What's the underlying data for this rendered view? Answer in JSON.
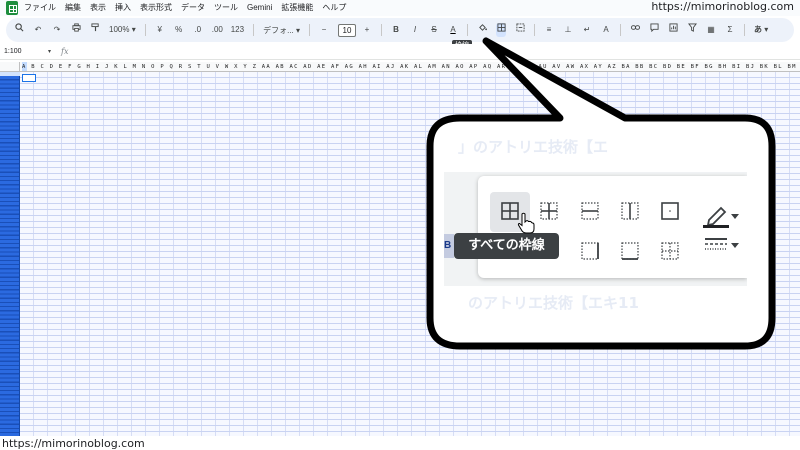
{
  "menubar": {
    "items": [
      "ファイル",
      "編集",
      "表示",
      "挿入",
      "表示形式",
      "データ",
      "ツール",
      "Gemini",
      "拡張機能",
      "ヘルプ"
    ]
  },
  "watermark": {
    "top": "https://mimorinoblog.com",
    "bottom": "https://mimorinoblog.com"
  },
  "toolbar": {
    "zoom": "100%",
    "currency": "¥",
    "percent": "%",
    "decimal_decrease": ".0",
    "decimal_increase": ".00",
    "format_123": "123",
    "font": "デフォ...",
    "font_size": "10",
    "minus": "−",
    "plus": "+",
    "bold": "B",
    "italic": "I",
    "strike": "S",
    "text_color": "A",
    "tooltip": "枠線",
    "more_lang": "あ"
  },
  "formula": {
    "namebox": "1:100",
    "fx": "fx"
  },
  "columns": {
    "letters": "A B C D E F G H I J K L M N O P Q R S T U V W X Y Z AA AB AC AD AE AF AG AH AI AJ AK AL AM AN AO AP AQ AR AS AT AU AV AW AX AY AZ BA BB BC BD BE BF BG BH BI BJ BK BL BM BN BO BP BQ BR BS BT BU BV BW BX BY BZ CA CB CC CD CE CF CG CH CI CJ CK CL CM CN CO CP CQ CR CS CT CU CV CW CX CY CZ DA DB DC DD DE DF DG DH DI DJ DK DL DM DN DO DP DQ DR DS DT DU DV DW DX DY DZ"
  },
  "callout": {
    "tooltip": "すべての枠線",
    "left_label": "B",
    "bg_text_top": "」のアトリエ技術【エ",
    "bg_text_bottom": "のアトリエ技術【エキ11"
  },
  "colors": {
    "accent": "#1a73e8",
    "toolbar_bg": "#edf2fa",
    "row_header": "#1a5fd8",
    "grid_bg": "#f6f8ff",
    "tooltip_bg": "#3c4043"
  }
}
